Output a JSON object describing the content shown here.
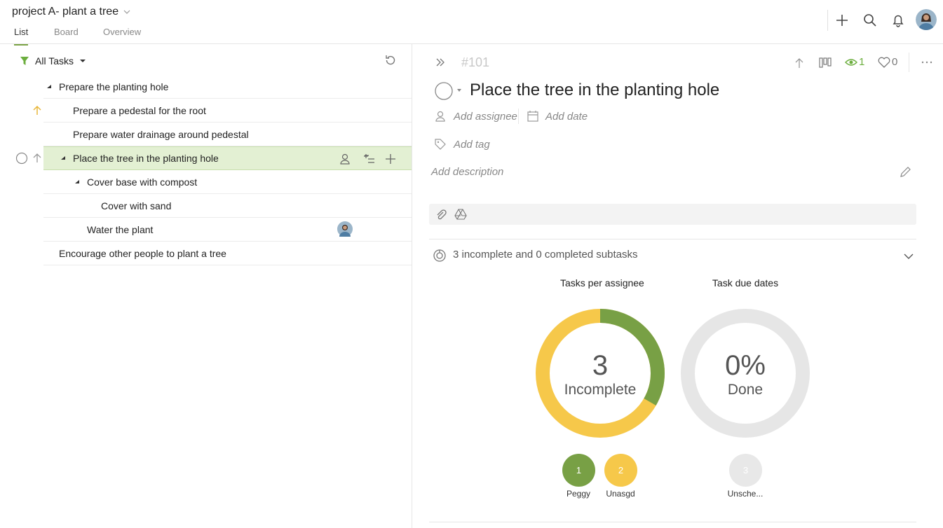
{
  "project": {
    "title": "project A- plant a tree"
  },
  "tabs": [
    {
      "label": "List",
      "active": true
    },
    {
      "label": "Board",
      "active": false
    },
    {
      "label": "Overview",
      "active": false
    }
  ],
  "filter": {
    "label": "All Tasks"
  },
  "tasks": [
    {
      "title": "Prepare the planting hole",
      "expanded": true
    },
    {
      "title": "Prepare a pedestal for the root",
      "priority_icon": "arrow-up-icon"
    },
    {
      "title": "Prepare water drainage around pedestal"
    },
    {
      "title": "Place the tree in the planting hole",
      "selected": true,
      "expanded": true
    },
    {
      "title": "Cover base with compost",
      "expanded": true
    },
    {
      "title": "Cover with sand"
    },
    {
      "title": "Water the plant",
      "assignee_avatar": true
    },
    {
      "title": "Encourage other people to plant a tree"
    }
  ],
  "detail": {
    "id": "#101",
    "title": "Place the tree in the planting hole",
    "add_assignee": "Add assignee",
    "add_date": "Add date",
    "add_tag": "Add tag",
    "add_description": "Add description",
    "watchers": "1",
    "likes": "0",
    "subtasks_summary": "3 incomplete and 0 completed subtasks"
  },
  "charts": {
    "assignee": {
      "title": "Tasks per assignee",
      "center_value": "3",
      "center_label": "Incomplete",
      "legend": [
        {
          "value": "1",
          "label": "Peggy",
          "color": "#78a045"
        },
        {
          "value": "2",
          "label": "Unasgd",
          "color": "#f6c84a"
        }
      ]
    },
    "due": {
      "title": "Task due dates",
      "center_value": "0%",
      "center_label": "Done",
      "legend": [
        {
          "value": "3",
          "label": "Unsche...",
          "color": "#e8e8e8"
        }
      ]
    }
  },
  "colors": {
    "accent": "#7aa244",
    "selected_row": "#e3f0d3",
    "unassigned": "#f6c84a"
  }
}
